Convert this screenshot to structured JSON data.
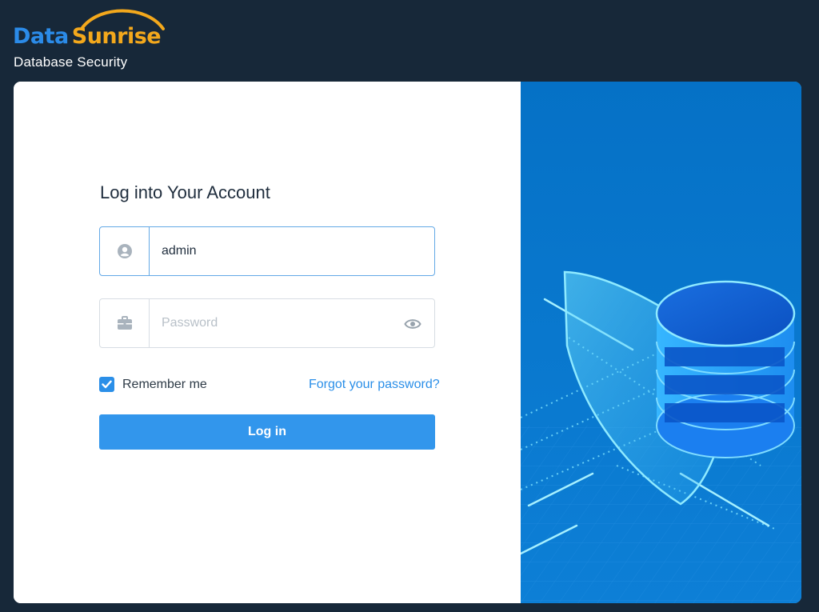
{
  "brand": {
    "logo_part1": "Data",
    "logo_part2": "Sunrise",
    "subtitle": "Database Security",
    "colors": {
      "data": "#2b8be8",
      "sunrise": "#f3a81c"
    }
  },
  "login": {
    "title": "Log into Your Account",
    "username": {
      "value": "admin",
      "icon": "user-circle-icon"
    },
    "password": {
      "value": "",
      "placeholder": "Password",
      "icon": "lock-briefcase-icon",
      "toggle_icon": "eye-icon"
    },
    "remember": {
      "label": "Remember me",
      "checked": true
    },
    "forgot_link": "Forgot your password?",
    "submit_label": "Log in"
  },
  "theme": {
    "background": "#172839",
    "accent": "#3296ec",
    "illustration_bg": "#0572c6"
  },
  "illustration": {
    "icon": "shield-database-illustration"
  }
}
